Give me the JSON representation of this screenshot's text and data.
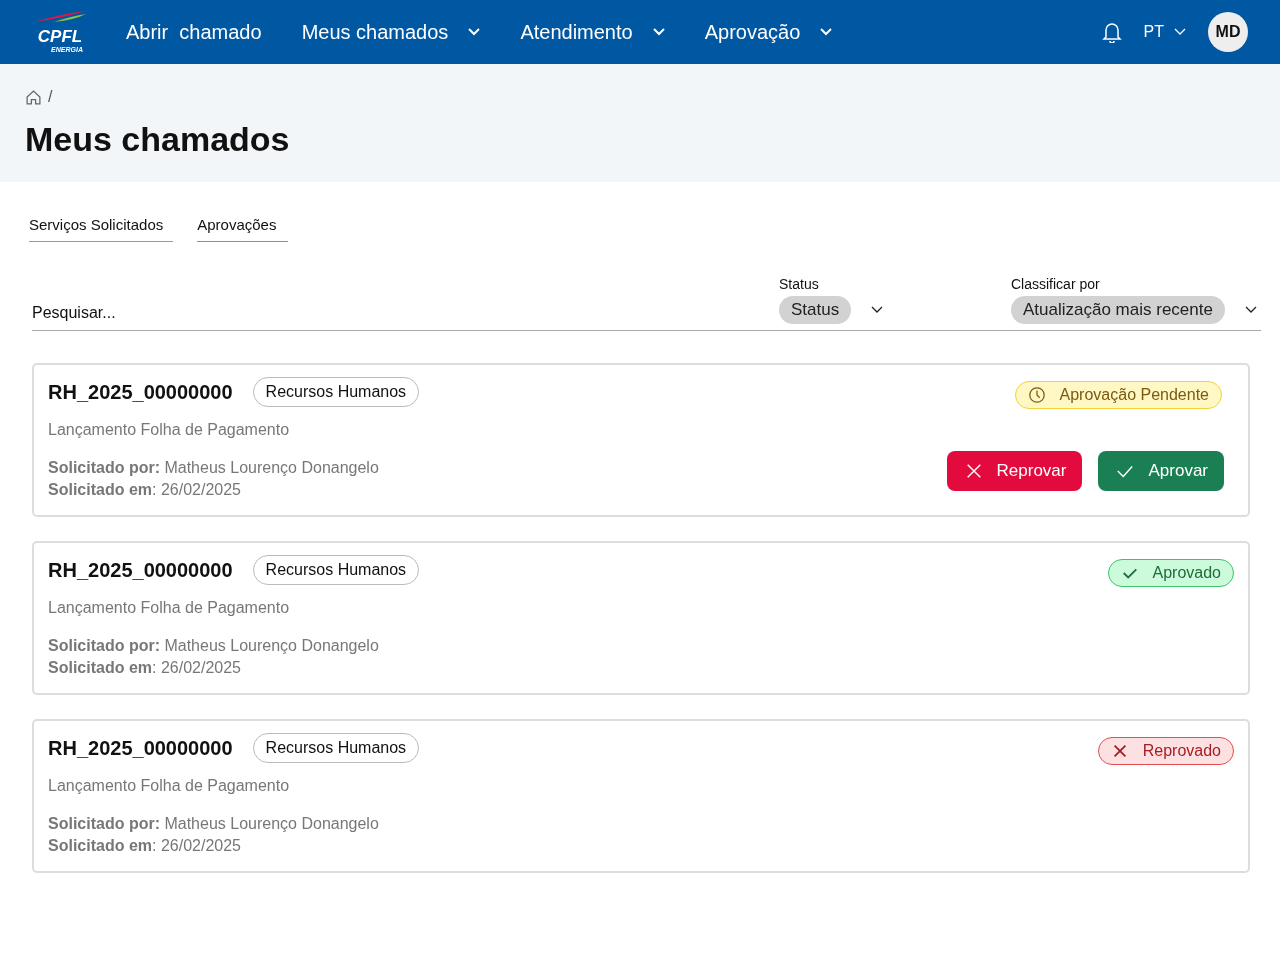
{
  "header": {
    "logo": {
      "name": "CPFL",
      "sub": "ENERGIA"
    },
    "nav": [
      {
        "label": "Abrir  chamado",
        "dropdown": false
      },
      {
        "label": "Meus chamados",
        "dropdown": true
      },
      {
        "label": "Atendimento",
        "dropdown": true
      },
      {
        "label": "Aprovação",
        "dropdown": true
      }
    ],
    "language": "PT",
    "avatar": "MD"
  },
  "breadcrumb": {
    "separator": "/"
  },
  "page_title": "Meus chamados",
  "tabs": [
    {
      "label": "Serviços Solicitados",
      "selected": false
    },
    {
      "label": "Aprovações",
      "selected": true
    }
  ],
  "filters": {
    "search": {
      "placeholder": "Pesquisar..."
    },
    "status": {
      "label": "Status",
      "value": "Status"
    },
    "sort": {
      "label": "Classificar por",
      "value": "Atualização mais recente"
    }
  },
  "requests": [
    {
      "id": "RH_2025_00000000",
      "department": "Recursos Humanos",
      "service": "Lançamento Folha de Pagamento",
      "requested_by": "**Solicitado por:** Matheus Lourenço Donangelo",
      "requested_at": "**Solicitado em**: 26/02/2025",
      "status": {
        "kind": "pending",
        "label": "Aprovação Pendente"
      },
      "actions": [
        {
          "kind": "reject",
          "label": "Reprovar"
        },
        {
          "kind": "approve",
          "label": "Aprovar"
        }
      ]
    },
    {
      "id": "RH_2025_00000000",
      "department": "Recursos Humanos",
      "service": "Lançamento Folha de Pagamento",
      "requested_by": "**Solicitado por:** Matheus Lourenço Donangelo",
      "requested_at": "**Solicitado em**: 26/02/2025",
      "status": {
        "kind": "approved",
        "label": "Aprovado"
      }
    },
    {
      "id": "RH_2025_00000000",
      "department": "Recursos Humanos",
      "service": "Lançamento Folha de Pagamento",
      "requested_by": "**Solicitado por:** Matheus Lourenço Donangelo",
      "requested_at": "**Solicitado em**: 26/02/2025",
      "status": {
        "kind": "rejected",
        "label": "Reprovado"
      }
    }
  ]
}
